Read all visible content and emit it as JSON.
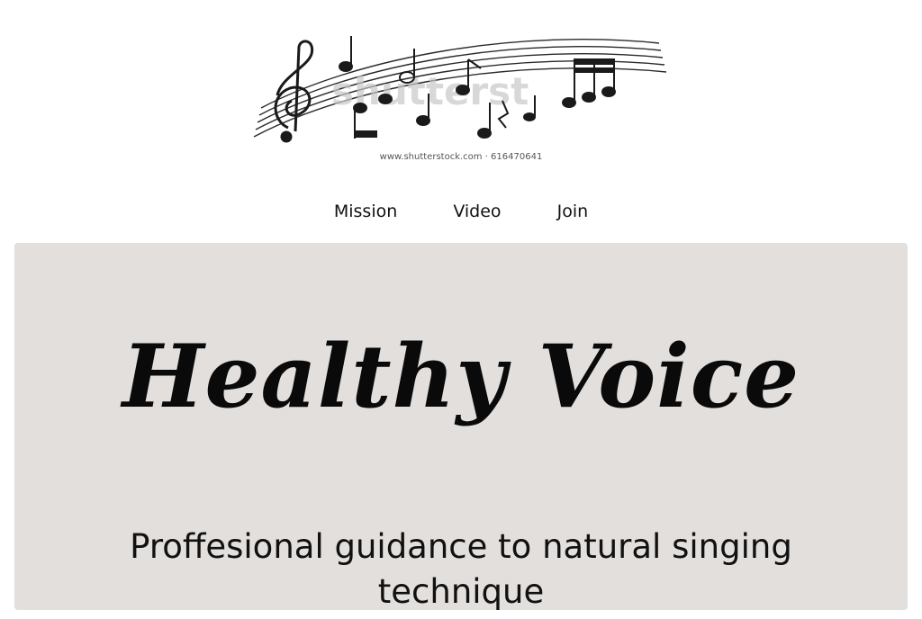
{
  "logo": {
    "icon": "music-staff-notes-icon",
    "watermark": "shutterstock",
    "caption": "www.shutterstock.com · 616470641"
  },
  "nav": {
    "items": [
      {
        "label": "Mission"
      },
      {
        "label": "Video"
      },
      {
        "label": "Join"
      }
    ]
  },
  "hero": {
    "title": "Healthy Voice",
    "subtitle": "Proffesional guidance to natural singing technique",
    "background": "#e2dfdd"
  }
}
